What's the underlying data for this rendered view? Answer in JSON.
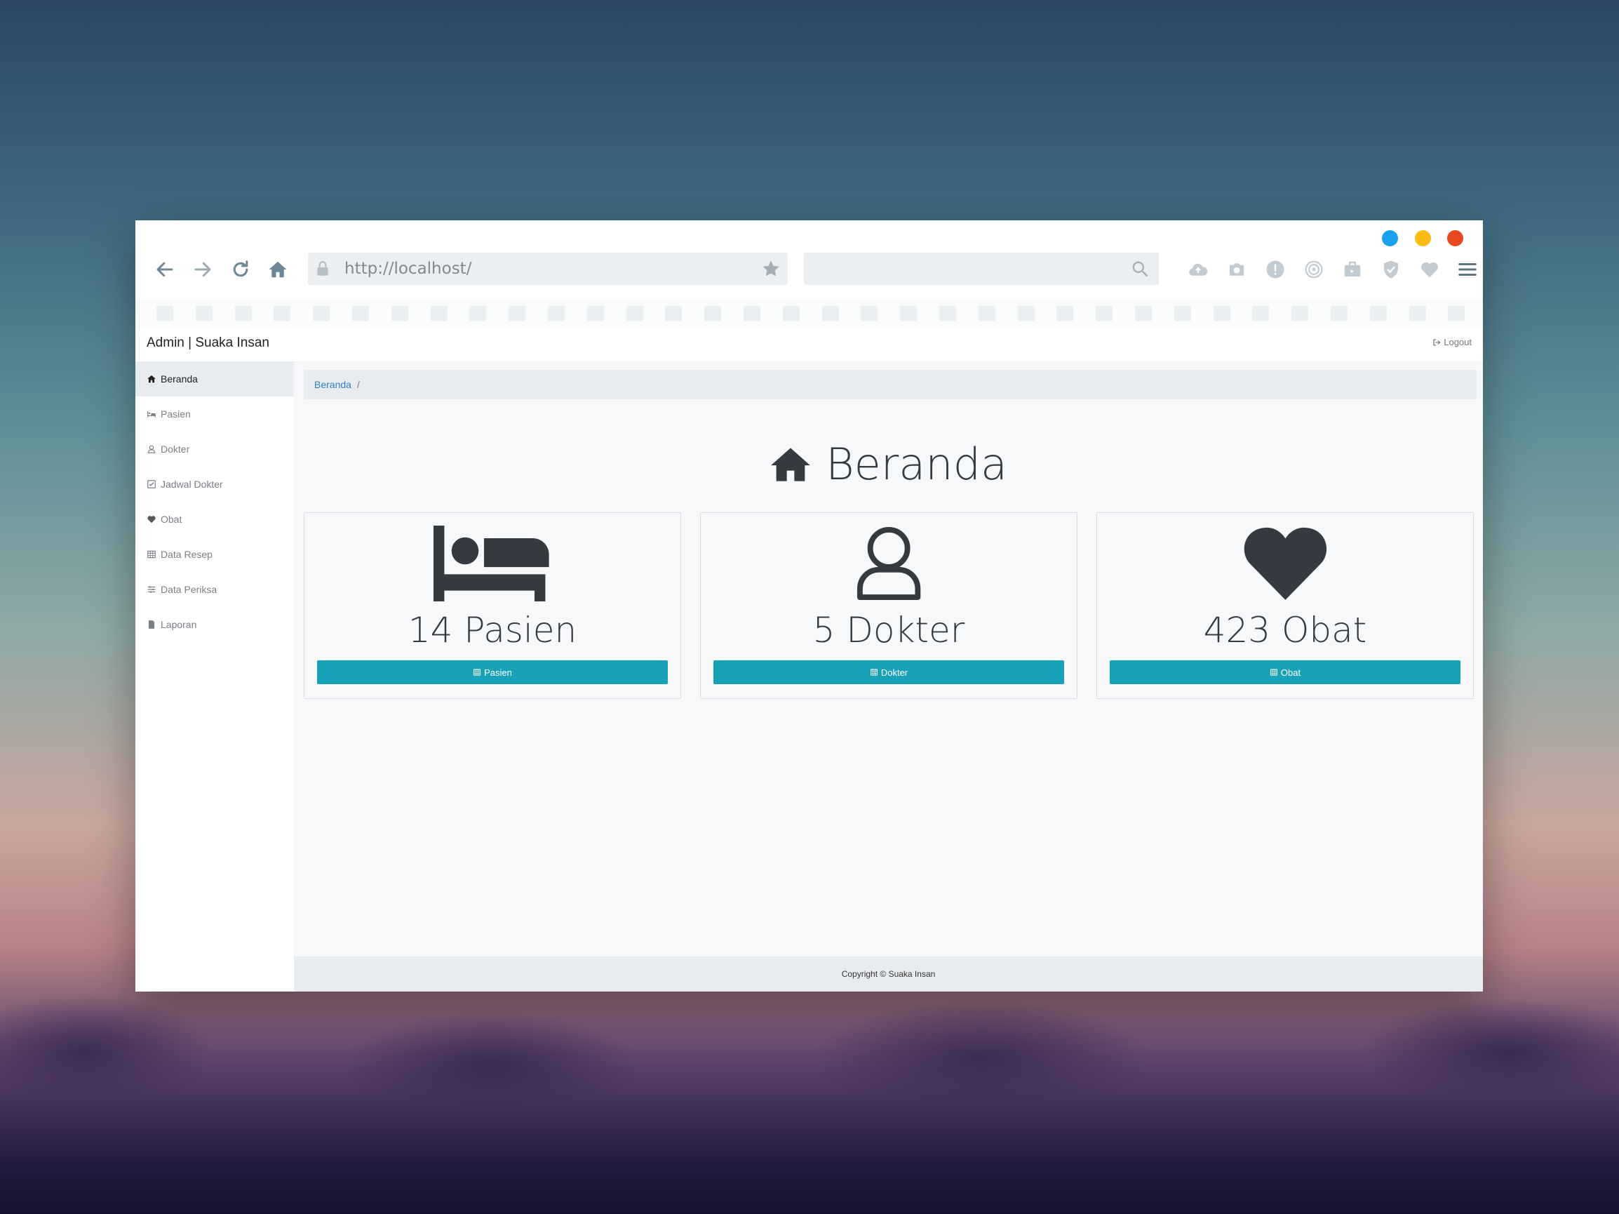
{
  "browser": {
    "url": "http://localhost/",
    "search_placeholder": "",
    "window_controls": [
      "minimize",
      "maximize",
      "close"
    ],
    "colors": {
      "blue_dot": "#1aa1f0",
      "yellow_dot": "#fdbb16",
      "red_dot": "#e8481f"
    },
    "nav_icons": [
      "back-arrow-icon",
      "forward-arrow-icon",
      "reload-icon",
      "home-icon"
    ],
    "tool_icons": [
      "cloud-upload-icon",
      "camera-icon",
      "alert-icon",
      "fingerprint-icon",
      "briefcase-icon",
      "shield-check-icon",
      "heart-icon",
      "menu-icon"
    ]
  },
  "app": {
    "brand": "Admin | Suaka Insan",
    "logout_label": "Logout"
  },
  "sidebar": {
    "items": [
      {
        "label": "Beranda",
        "icon": "home-icon",
        "active": true
      },
      {
        "label": "Pasien",
        "icon": "bed-icon",
        "active": false
      },
      {
        "label": "Dokter",
        "icon": "user-icon",
        "active": false
      },
      {
        "label": "Jadwal Dokter",
        "icon": "check-square-icon",
        "active": false
      },
      {
        "label": "Obat",
        "icon": "heart-icon",
        "active": false
      },
      {
        "label": "Data Resep",
        "icon": "table-icon",
        "active": false
      },
      {
        "label": "Data Periksa",
        "icon": "sliders-icon",
        "active": false
      },
      {
        "label": "Laporan",
        "icon": "file-icon",
        "active": false
      }
    ]
  },
  "breadcrumb": {
    "current": "Beranda",
    "separator": "/"
  },
  "main": {
    "title": "Beranda",
    "cards": [
      {
        "count": "14 Pasien",
        "button_label": "Pasien",
        "icon": "bed-icon"
      },
      {
        "count": "5 Dokter",
        "button_label": "Dokter",
        "icon": "user-icon"
      },
      {
        "count": "423 Obat",
        "button_label": "Obat",
        "icon": "heart-icon"
      }
    ],
    "accent_color": "#17a2b8"
  },
  "footer": {
    "text": "Copyright © Suaka Insan"
  }
}
